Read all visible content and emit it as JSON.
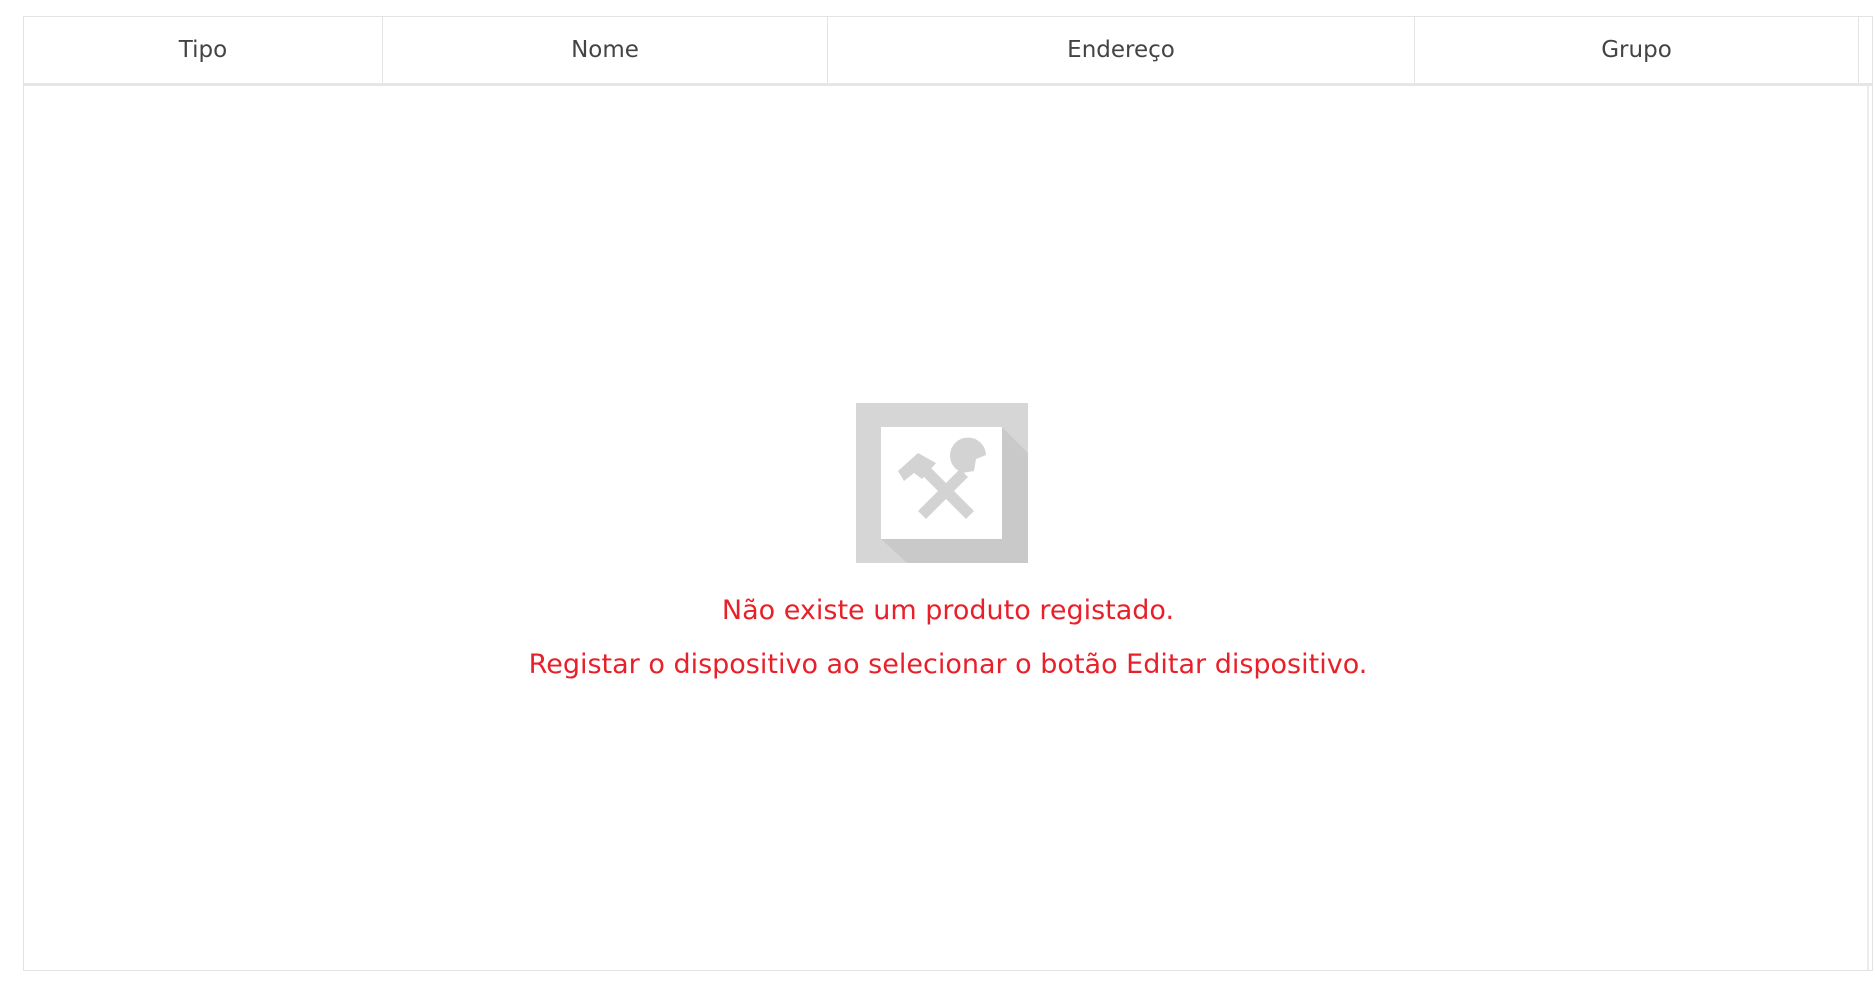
{
  "table": {
    "columns": [
      "Tipo",
      "Nome",
      "Endereço",
      "Grupo"
    ]
  },
  "empty_state": {
    "icon": "tools-icon",
    "line1": "Não existe um produto registado.",
    "line2": "Registar o dispositivo ao selecionar o botão Editar dispositivo.",
    "message_color": "#e8202a"
  }
}
